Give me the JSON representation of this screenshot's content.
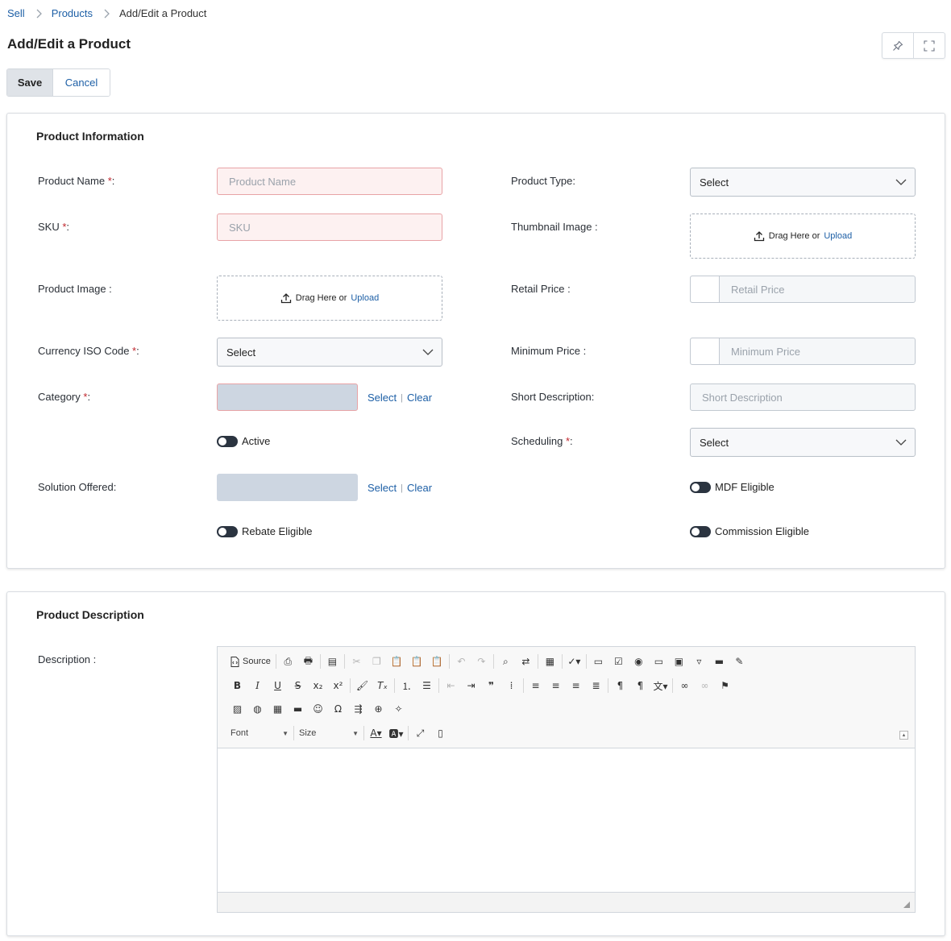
{
  "breadcrumb": {
    "items": [
      "Sell",
      "Products"
    ],
    "current": "Add/Edit a Product"
  },
  "page": {
    "title": "Add/Edit a Product"
  },
  "toolbar": {
    "save_label": "Save",
    "cancel_label": "Cancel",
    "pin_icon": "pin-icon",
    "fullscreen_icon": "expand-icon"
  },
  "product_info": {
    "title": "Product Information",
    "required_mark": "*",
    "product_name": {
      "label": "Product Name ",
      "suffix": ":",
      "placeholder": "Product Name"
    },
    "sku": {
      "label": "SKU ",
      "suffix": ":",
      "placeholder": "SKU"
    },
    "product_image": {
      "label": "Product Image :",
      "drag_text": "Drag Here or",
      "upload_text": "Upload"
    },
    "currency": {
      "label": "Currency ISO Code ",
      "suffix": ":",
      "value": "Select"
    },
    "category": {
      "label": "Category ",
      "suffix": ":",
      "select_link": "Select",
      "clear_link": "Clear"
    },
    "active": {
      "label": "Active"
    },
    "solution_offered": {
      "label": "Solution Offered:",
      "select_link": "Select",
      "clear_link": "Clear"
    },
    "rebate_eligible": {
      "label": "Rebate Eligible"
    },
    "product_type": {
      "label": "Product Type:",
      "value": "Select"
    },
    "thumbnail": {
      "label": "Thumbnail Image :",
      "drag_text": "Drag Here or",
      "upload_text": "Upload"
    },
    "retail_price": {
      "label": "Retail Price :",
      "placeholder": "Retail Price"
    },
    "minimum_price": {
      "label": "Minimum Price :",
      "placeholder": "Minimum Price"
    },
    "short_description": {
      "label": "Short Description:",
      "placeholder": "Short Description"
    },
    "scheduling": {
      "label": "Scheduling ",
      "suffix": ":",
      "value": "Select"
    },
    "mdf_eligible": {
      "label": "MDF Eligible"
    },
    "commission_eligible": {
      "label": "Commission Eligible"
    }
  },
  "product_desc": {
    "title": "Product Description",
    "description_label": "Description :",
    "editor": {
      "source_label": "Source",
      "font_label": "Font",
      "size_label": "Size"
    }
  },
  "colors": {
    "link": "#1d5fa6",
    "required": "#c0262d",
    "error_border": "#e8a3a6",
    "toggle_track": "#2b3440"
  }
}
